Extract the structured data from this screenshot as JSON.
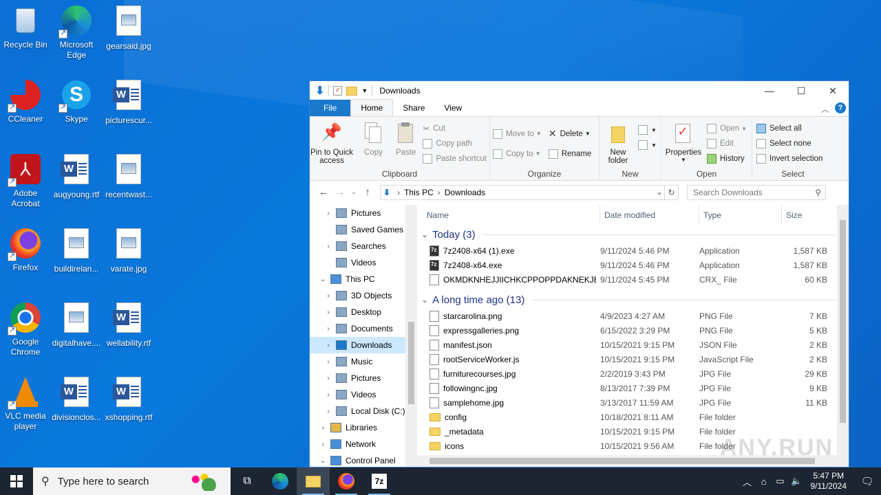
{
  "desktop": {
    "icons": [
      {
        "label": "Recycle Bin",
        "icon": "recycle-bin-icon"
      },
      {
        "label": "Microsoft Edge",
        "icon": "edge-icon"
      },
      {
        "label": "gearsaid.jpg",
        "icon": "image-file-icon"
      },
      {
        "label": "CCleaner",
        "icon": "ccleaner-icon"
      },
      {
        "label": "Skype",
        "icon": "skype-icon"
      },
      {
        "label": "picturescur...",
        "icon": "word-file-icon"
      },
      {
        "label": "Adobe Acrobat",
        "icon": "acrobat-icon"
      },
      {
        "label": "augyoung.rtf",
        "icon": "word-file-icon"
      },
      {
        "label": "recentwast...",
        "icon": "image-file-icon"
      },
      {
        "label": "Firefox",
        "icon": "firefox-icon"
      },
      {
        "label": "buildirelan...",
        "icon": "image-file-icon"
      },
      {
        "label": "varate.jpg",
        "icon": "image-file-icon"
      },
      {
        "label": "Google Chrome",
        "icon": "chrome-icon"
      },
      {
        "label": "digitalhave....",
        "icon": "image-file-icon"
      },
      {
        "label": "wellability.rtf",
        "icon": "word-file-icon"
      },
      {
        "label": "VLC media player",
        "icon": "vlc-icon"
      },
      {
        "label": "divisionclos...",
        "icon": "word-file-icon"
      },
      {
        "label": "xshopping.rtf",
        "icon": "word-file-icon"
      }
    ]
  },
  "window": {
    "title": "Downloads",
    "controls": {
      "minimize": "—",
      "maximize": "☐",
      "close": "✕"
    },
    "tabs": [
      "File",
      "Home",
      "Share",
      "View"
    ],
    "active_tab": "Home",
    "ribbon": {
      "clipboard": {
        "label": "Clipboard",
        "pin": "Pin to Quick access",
        "copy": "Copy",
        "paste": "Paste",
        "cut": "Cut",
        "copy_path": "Copy path",
        "paste_shortcut": "Paste shortcut"
      },
      "organize": {
        "label": "Organize",
        "move_to": "Move to",
        "copy_to": "Copy to",
        "delete": "Delete",
        "rename": "Rename"
      },
      "new": {
        "label": "New",
        "new_folder": "New folder"
      },
      "open": {
        "label": "Open",
        "properties": "Properties",
        "open": "Open",
        "edit": "Edit",
        "history": "History"
      },
      "select": {
        "label": "Select",
        "select_all": "Select all",
        "select_none": "Select none",
        "invert": "Invert selection"
      }
    },
    "address": {
      "crumbs": [
        "This PC",
        "Downloads"
      ],
      "search_placeholder": "Search Downloads"
    },
    "tree": [
      {
        "label": "Pictures",
        "expand": "›",
        "indent": 1,
        "selected": false
      },
      {
        "label": "Saved Games",
        "expand": "",
        "indent": 1,
        "selected": false
      },
      {
        "label": "Searches",
        "expand": "›",
        "indent": 1,
        "selected": false
      },
      {
        "label": "Videos",
        "expand": "",
        "indent": 1,
        "selected": false
      },
      {
        "label": "This PC",
        "expand": "⌄",
        "indent": 0,
        "selected": false
      },
      {
        "label": "3D Objects",
        "expand": "›",
        "indent": 1,
        "selected": false
      },
      {
        "label": "Desktop",
        "expand": "›",
        "indent": 1,
        "selected": false
      },
      {
        "label": "Documents",
        "expand": "›",
        "indent": 1,
        "selected": false
      },
      {
        "label": "Downloads",
        "expand": "›",
        "indent": 1,
        "selected": true
      },
      {
        "label": "Music",
        "expand": "›",
        "indent": 1,
        "selected": false
      },
      {
        "label": "Pictures",
        "expand": "›",
        "indent": 1,
        "selected": false
      },
      {
        "label": "Videos",
        "expand": "›",
        "indent": 1,
        "selected": false
      },
      {
        "label": "Local Disk (C:)",
        "expand": "›",
        "indent": 1,
        "selected": false
      },
      {
        "label": "Libraries",
        "expand": "›",
        "indent": 0,
        "selected": false
      },
      {
        "label": "Network",
        "expand": "›",
        "indent": 0,
        "selected": false
      },
      {
        "label": "Control Panel",
        "expand": "⌄",
        "indent": 0,
        "selected": false
      }
    ],
    "columns": [
      "Name",
      "Date modified",
      "Type",
      "Size"
    ],
    "groups": [
      {
        "title": "Today (3)",
        "rows": [
          {
            "name": "7z2408-x64 (1).exe",
            "date": "9/11/2024 5:46 PM",
            "type": "Application",
            "size": "1,587 KB",
            "icon": "exe"
          },
          {
            "name": "7z2408-x64.exe",
            "date": "9/11/2024 5:46 PM",
            "type": "Application",
            "size": "1,587 KB",
            "icon": "exe"
          },
          {
            "name": "OKMDKNHEJJIICHKCPPOPPDAKNEKJEK...",
            "date": "9/11/2024 5:45 PM",
            "type": "CRX_ File",
            "size": "60 KB",
            "icon": "file"
          }
        ]
      },
      {
        "title": "A long time ago (13)",
        "rows": [
          {
            "name": "starcarolina.png",
            "date": "4/9/2023 4:27 AM",
            "type": "PNG File",
            "size": "7 KB",
            "icon": "file"
          },
          {
            "name": "expressgalleries.png",
            "date": "6/15/2022 3:29 PM",
            "type": "PNG File",
            "size": "5 KB",
            "icon": "file"
          },
          {
            "name": "manifest.json",
            "date": "10/15/2021 9:15 PM",
            "type": "JSON File",
            "size": "2 KB",
            "icon": "file"
          },
          {
            "name": "rootServiceWorker.js",
            "date": "10/15/2021 9:15 PM",
            "type": "JavaScript File",
            "size": "2 KB",
            "icon": "file"
          },
          {
            "name": "furniturecourses.jpg",
            "date": "2/2/2019 3:43 PM",
            "type": "JPG File",
            "size": "29 KB",
            "icon": "file"
          },
          {
            "name": "followingnc.jpg",
            "date": "8/13/2017 7:39 PM",
            "type": "JPG File",
            "size": "9 KB",
            "icon": "file"
          },
          {
            "name": "samplehome.jpg",
            "date": "3/13/2017 11:59 AM",
            "type": "JPG File",
            "size": "11 KB",
            "icon": "file"
          },
          {
            "name": "config",
            "date": "10/18/2021 8:11 AM",
            "type": "File folder",
            "size": "",
            "icon": "folder"
          },
          {
            "name": "_metadata",
            "date": "10/15/2021 9:15 PM",
            "type": "File folder",
            "size": "",
            "icon": "folder"
          },
          {
            "name": "icons",
            "date": "10/15/2021 9:56 AM",
            "type": "File folder",
            "size": "",
            "icon": "folder"
          }
        ]
      }
    ],
    "watermark": "ANY.RUN"
  },
  "taskbar": {
    "search_placeholder": "Type here to search",
    "clock_time": "5:47 PM",
    "clock_date": "9/11/2024"
  },
  "colors": {
    "accent": "#1979ca",
    "selection": "#cce8ff",
    "taskbar": "#1c2531"
  }
}
